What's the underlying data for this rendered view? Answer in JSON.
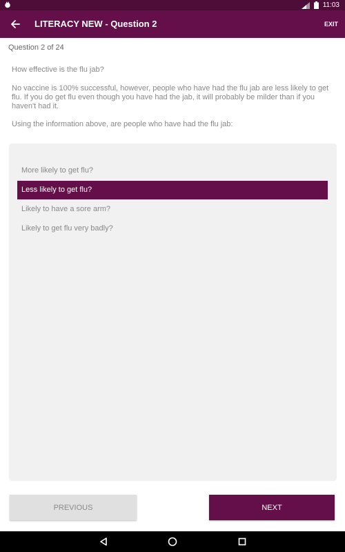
{
  "status_bar": {
    "time": "11:03"
  },
  "app_bar": {
    "title": "LITERACY NEW - Question 2",
    "exit_label": "EXIT"
  },
  "question": {
    "counter": "Question 2 of 24",
    "title": "How effective is the flu jab?",
    "body": "No vaccine is 100% successful, however, people who have had the flu jab are less likely to get flu. If you do get flu even though you have had the jab, it will probably be milder than if you haven't had it.",
    "prompt": "Using the information above, are people who have had the flu jab:"
  },
  "answers": [
    {
      "label": "More likely to get flu?",
      "selected": false
    },
    {
      "label": "Less likely to get flu?",
      "selected": true
    },
    {
      "label": "Likely to have a sore arm?",
      "selected": false
    },
    {
      "label": "Likely to get flu very badly?",
      "selected": false
    }
  ],
  "buttons": {
    "previous_label": "PREVIOUS",
    "next_label": "NEXT"
  },
  "colors": {
    "primary": "#640f49",
    "status_bar": "#4e0c38",
    "panel": "#f1f1f1"
  }
}
